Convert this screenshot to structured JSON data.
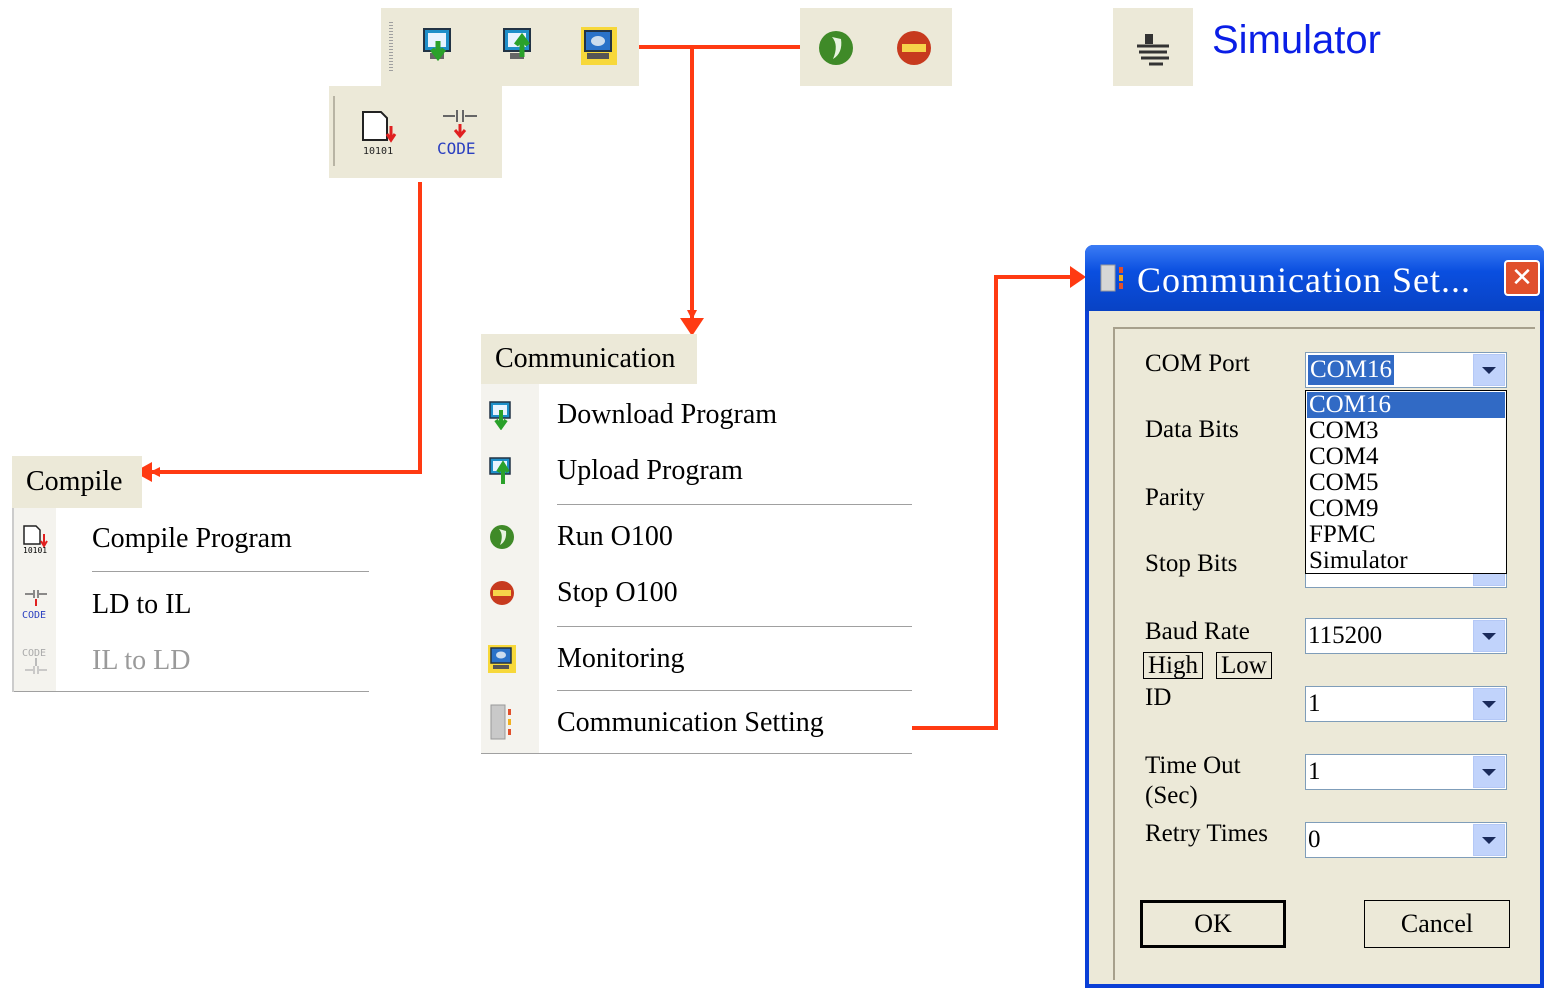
{
  "toolbar": {
    "comm_buttons": [
      "download-program",
      "upload-program",
      "monitoring"
    ],
    "run_buttons": [
      "run",
      "stop"
    ],
    "compile_buttons": [
      "compile-program",
      "ld-to-il"
    ],
    "compile_code_label": "CODE",
    "compile_bits_label": "10101"
  },
  "simulator": {
    "label": "Simulator"
  },
  "compile_menu": {
    "title": "Compile",
    "items": [
      {
        "label": "Compile Program",
        "enabled": true
      },
      {
        "label": "LD to IL",
        "enabled": true
      },
      {
        "label": "IL to LD",
        "enabled": false
      }
    ]
  },
  "communication_menu": {
    "title": "Communication",
    "items": [
      {
        "label": "Download Program"
      },
      {
        "label": "Upload Program"
      },
      {
        "label": "Run O100"
      },
      {
        "label": "Stop O100"
      },
      {
        "label": "Monitoring"
      },
      {
        "label": "Communication Setting"
      }
    ]
  },
  "dialog": {
    "title": "Communication Set...",
    "com_port": {
      "label": "COM Port",
      "value": "COM16",
      "options": [
        "COM16",
        "COM3",
        "COM4",
        "COM5",
        "COM9",
        "FPMC",
        "Simulator"
      ]
    },
    "data_bits": {
      "label": "Data Bits"
    },
    "parity": {
      "label": "Parity"
    },
    "stop_bits": {
      "label": "Stop Bits"
    },
    "baud_rate": {
      "label": "Baud Rate",
      "value": "115200",
      "high": "High",
      "low": "Low"
    },
    "id": {
      "label": "ID",
      "value": "1"
    },
    "time_out": {
      "label": "Time Out",
      "label2": "(Sec)",
      "value": "1"
    },
    "retry": {
      "label": "Retry Times",
      "value": "0"
    },
    "ok": "OK",
    "cancel": "Cancel"
  },
  "colors": {
    "arrow": "#ff3a12",
    "menu_bg": "#ece9d8",
    "title_blue": "#0a4fe0",
    "simulator_text": "#0a1ee6"
  }
}
